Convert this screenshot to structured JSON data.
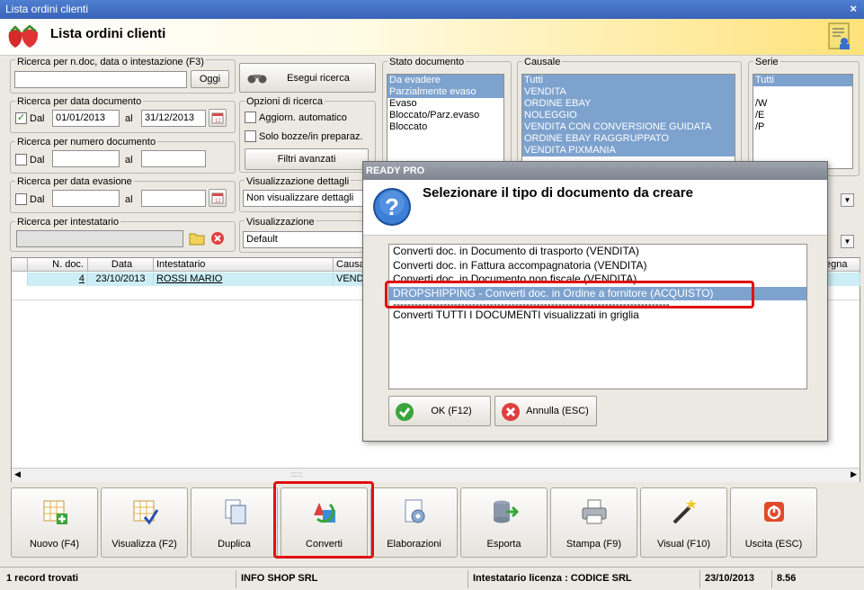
{
  "window": {
    "title": "Lista ordini clienti",
    "close": "×"
  },
  "header": {
    "title": "Lista ordini clienti"
  },
  "search_text": {
    "legend": "Ricerca per n.doc, data o intestazione (F3)",
    "value": "",
    "today_btn": "Oggi",
    "exec_btn": "Esegui ricerca"
  },
  "date_doc": {
    "legend": "Ricerca per data documento",
    "from_label": "Dal",
    "from": "01/01/2013",
    "to_label": "al",
    "to": "31/12/2013",
    "checked": "✓"
  },
  "num_doc": {
    "legend": "Ricerca per numero documento",
    "from_label": "Dal",
    "to_label": "al"
  },
  "date_evas": {
    "legend": "Ricerca per data evasione",
    "from_label": "Dal",
    "to_label": "al"
  },
  "holder": {
    "legend": "Ricerca per intestatario"
  },
  "options": {
    "legend": "Opzioni di ricerca",
    "auto_update": "Aggiorn. automatico",
    "drafts_only": "Solo bozze/in preparaz.",
    "advanced": "Filtri avanzati"
  },
  "detail_view": {
    "legend": "Visualizzazione dettagli",
    "value": "Non visualizzare dettagli"
  },
  "view": {
    "legend": "Visualizzazione",
    "value": "Default"
  },
  "stato": {
    "legend": "Stato documento",
    "items": [
      "Da evadere",
      "Parzialmente evaso",
      "Evaso",
      "Bloccato/Parz.evaso",
      "Bloccato"
    ]
  },
  "causale": {
    "legend": "Causale",
    "items": [
      "Tutti",
      "VENDITA",
      "ORDINE EBAY",
      "NOLEGGIO",
      "VENDITA CON CONVERSIONE GUIDATA",
      "ORDINE EBAY RAGGRUPPATO",
      "VENDITA PIXMANIA"
    ]
  },
  "serie": {
    "legend": "Serie",
    "items": [
      "Tutti",
      "",
      "/W",
      "/E",
      "/P"
    ]
  },
  "grid": {
    "headers": [
      "N. doc.",
      "Data",
      "Intestatario",
      "Causa"
    ],
    "tail_header": "egna",
    "row": {
      "num": "4",
      "date": "23/10/2013",
      "holder": "ROSSI MARIO",
      "causale": "VEND"
    }
  },
  "toolbar": [
    {
      "label": "Nuovo (F4)",
      "icon": "grid-add-icon"
    },
    {
      "label": "Visualizza (F2)",
      "icon": "grid-check-icon"
    },
    {
      "label": "Duplica",
      "icon": "duplicate-icon"
    },
    {
      "label": "Converti",
      "icon": "convert-icon"
    },
    {
      "label": "Elaborazioni",
      "icon": "gear-doc-icon"
    },
    {
      "label": "Esporta",
      "icon": "database-export-icon"
    },
    {
      "label": "Stampa (F9)",
      "icon": "printer-icon"
    },
    {
      "label": "Visual (F10)",
      "icon": "magic-wand-icon"
    },
    {
      "label": "Uscita (ESC)",
      "icon": "exit-icon"
    }
  ],
  "status": {
    "records": "1 record trovati",
    "company": "INFO SHOP SRL",
    "license": "Intestatario licenza : CODICE SRL",
    "date": "23/10/2013",
    "version": "8.56"
  },
  "dialog": {
    "title": "READY PRO",
    "message": "Selezionare il tipo di documento da creare",
    "options": [
      "Converti doc. in Documento di trasporto (VENDITA)",
      "Converti doc. in Fattura accompagnatoria (VENDITA)",
      "Converti doc. in Documento non fiscale (VENDITA)",
      "DROPSHIPPING - Converti doc. in Ordine a fornitore (ACQUISTO)",
      "-----------------------------------------------------------------------------",
      "Converti TUTTI I DOCUMENTI visualizzati in griglia"
    ],
    "ok": "OK (F12)",
    "cancel": "Annulla (ESC)"
  }
}
